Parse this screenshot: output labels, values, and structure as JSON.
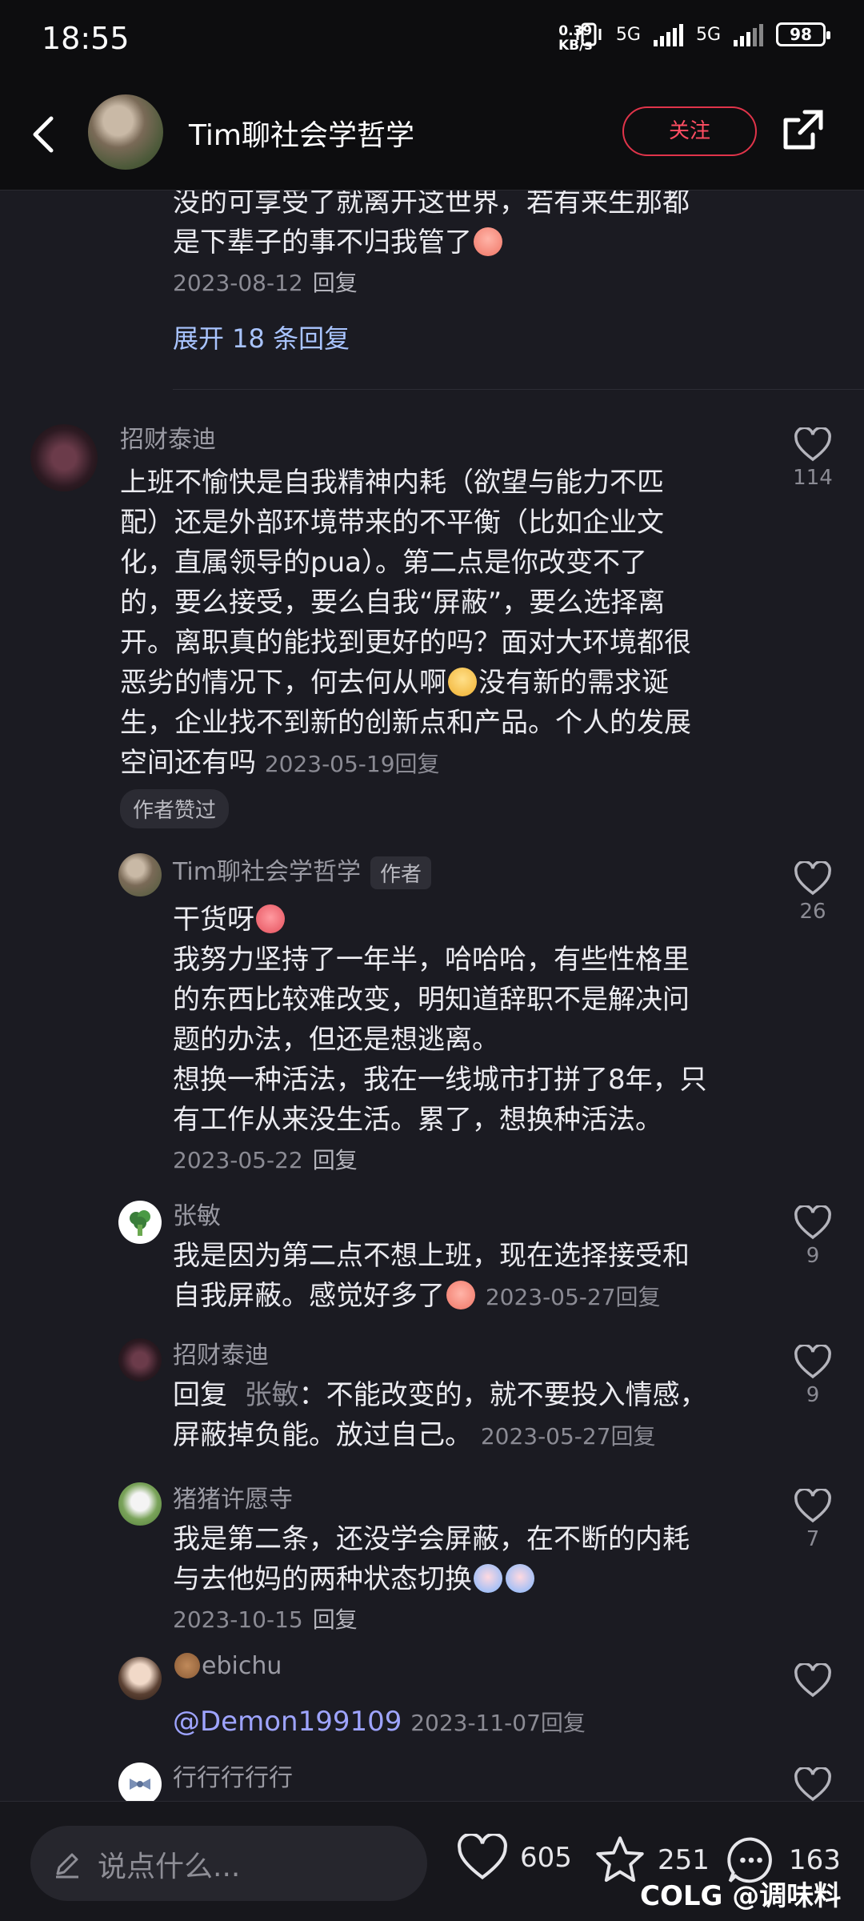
{
  "status": {
    "time": "18:55",
    "net_speed": "0.39",
    "net_unit": "KB/s",
    "battery": "98",
    "net_labels": [
      "5G",
      "5G"
    ]
  },
  "header": {
    "title": "Tim聊社会学哲学",
    "follow_label": "关注"
  },
  "prev_thread": {
    "tail_line1": "没的可享受了就离开这世界，若有来生那都",
    "tail_line2": "是下辈子的事不归我管了",
    "date": "2023-08-12",
    "reply": "回复",
    "expand": "展开 18 条回复"
  },
  "comment": {
    "name": "招财泰迪",
    "lines": [
      "上班不愉快是自我精神内耗（欲望与能力不匹",
      "配）还是外部环境带来的不平衡（比如企业文",
      "化，直属领导的pua）。第二点是你改变不了",
      "的，要么接受，要么自我“屏蔽”，要么选择离",
      "开。离职真的能找到更好的吗？面对大环境都很",
      "恶劣的情况下，何去何从啊",
      "没有新的需求诞",
      "生，企业找不到新的创新点和产品。个人的发展",
      "空间还有吗"
    ],
    "date": "2023-05-19",
    "reply": "回复",
    "liked_tag": "作者赞过",
    "likes": "114"
  },
  "replies": [
    {
      "name": "Tim聊社会学哲学",
      "tag": "作者",
      "lines": [
        "干货呀",
        "我努力坚持了一年半，哈哈哈，有些性格里",
        "的东西比较难改变，明知道辞职不是解决问",
        "题的办法，但还是想逃离。",
        "想换一种活法，我在一线城市打拼了8年，只",
        "有工作从来没生活。累了，想换种活法。"
      ],
      "date": "2023-05-22",
      "reply": "回复",
      "likes": "26"
    },
    {
      "name": "张敏",
      "lines": [
        "我是因为第二点不想上班，现在选择接受和",
        "自我屏蔽。感觉好多了"
      ],
      "date": "2023-05-27",
      "reply": "回复",
      "likes": "9"
    },
    {
      "name": "招财泰迪",
      "reply_prefix": "回复",
      "reply_target": "张敏",
      "line1_rest": "：不能改变的，就不要投入情感，",
      "line2": "屏蔽掉负能。放过自己。",
      "date": "2023-05-27",
      "reply": "回复",
      "likes": "9"
    },
    {
      "name": "猪猪许愿寺",
      "lines": [
        "我是第二条，还没学会屏蔽，在不断的内耗",
        "与去他妈的两种状态切换"
      ],
      "date": "2023-10-15",
      "reply": "回复",
      "likes": "7"
    },
    {
      "name": "ebichu",
      "text": "@Demon199109",
      "date": "2023-11-07",
      "reply": "回复"
    },
    {
      "name": "行行行行行"
    }
  ],
  "bottom": {
    "input_placeholder": "说点什么...",
    "likes": "605",
    "stars": "251",
    "comments": "163",
    "watermark": "COLG @调味料"
  },
  "colors": {
    "accent_red": "#e0344a",
    "link_blue": "#a9c4ff",
    "background": "#1b1b22"
  }
}
